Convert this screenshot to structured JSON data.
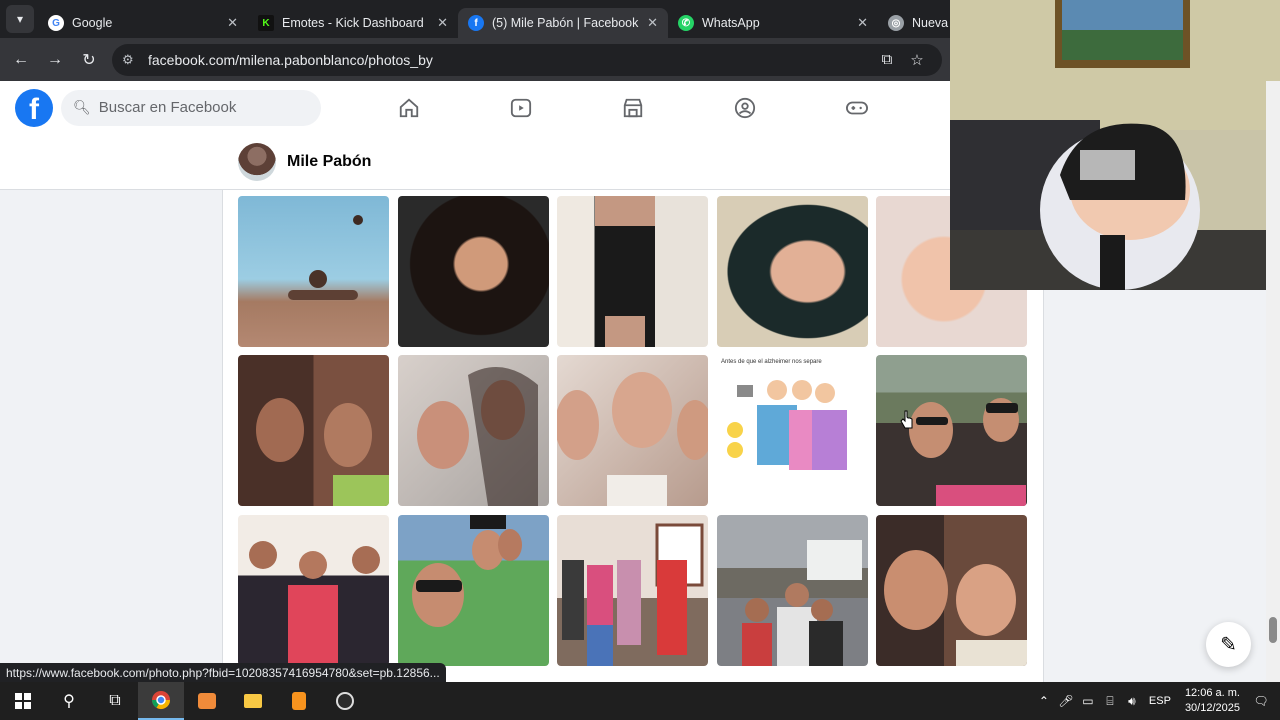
{
  "browser": {
    "tabs": [
      {
        "title": "Google",
        "favicon": "google-icon",
        "color": "#4285f4"
      },
      {
        "title": "Emotes - Kick Dashboard",
        "favicon": "kick-icon",
        "color": "#53fc18"
      },
      {
        "title": "(5) Mile Pabón | Facebook",
        "favicon": "facebook-icon",
        "color": "#1877f2"
      },
      {
        "title": "WhatsApp",
        "favicon": "whatsapp-icon",
        "color": "#25d366"
      },
      {
        "title": "Nueva pes",
        "favicon": "chrome-icon",
        "color": "#9aa0a6"
      }
    ],
    "url": "facebook.com/milena.pabonblanco/photos_by",
    "status_url": "https://www.facebook.com/photo.php?fbid=10208357416954780&set=pb.12856..."
  },
  "facebook": {
    "search_placeholder": "Buscar en Facebook",
    "nav": [
      "home-icon",
      "video-icon",
      "marketplace-icon",
      "groups-icon",
      "gaming-icon"
    ],
    "profile_name": "Mile Pabón",
    "photo_caption_text": "Antes de que el alzheimer nos separe",
    "photos": [
      {
        "desc": "pool-boy"
      },
      {
        "desc": "woman-smile"
      },
      {
        "desc": "black-dress"
      },
      {
        "desc": "woman-selfie"
      },
      {
        "desc": "baby"
      },
      {
        "desc": "two-people"
      },
      {
        "desc": "woman-girl"
      },
      {
        "desc": "selfie-group"
      },
      {
        "desc": "cartoon"
      },
      {
        "desc": "sunglasses-group"
      },
      {
        "desc": "three-women"
      },
      {
        "desc": "pool-selfie"
      },
      {
        "desc": "family-group"
      },
      {
        "desc": "outdoor-family"
      },
      {
        "desc": "mother-son"
      }
    ]
  },
  "taskbar": {
    "language": "ESP",
    "time": "12:06 a. m.",
    "date": "30/12/2025"
  }
}
